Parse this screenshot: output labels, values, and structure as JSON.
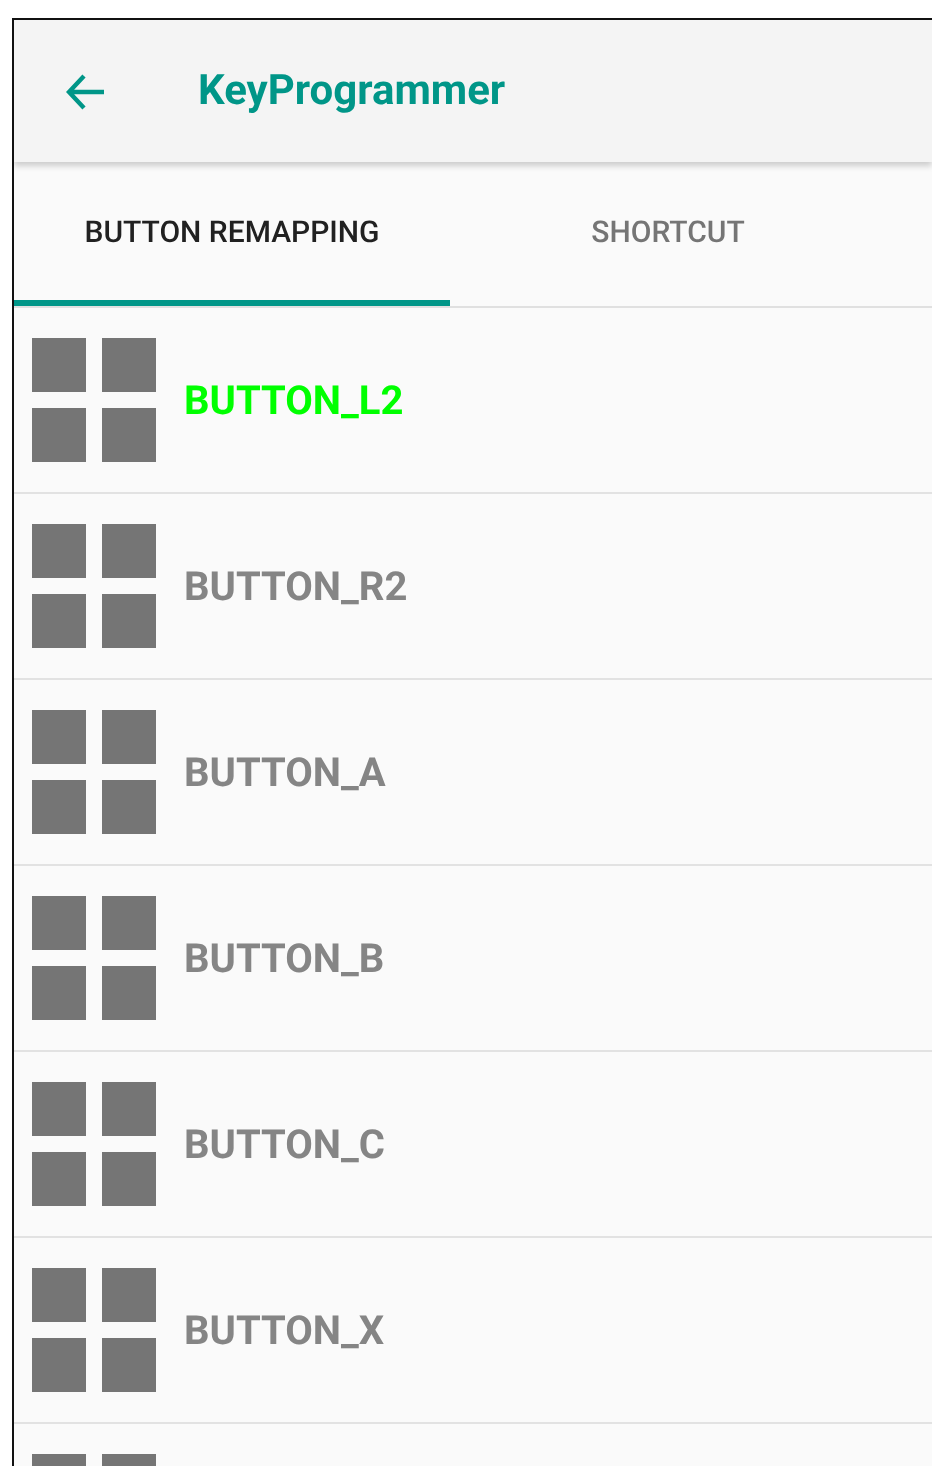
{
  "app_bar": {
    "title": "KeyProgrammer"
  },
  "tabs": [
    {
      "label": "BUTTON REMAPPING",
      "selected": true
    },
    {
      "label": "SHORTCUT",
      "selected": false
    }
  ],
  "buttons": [
    {
      "label": "BUTTON_L2",
      "selected": true
    },
    {
      "label": "BUTTON_R2",
      "selected": false
    },
    {
      "label": "BUTTON_A",
      "selected": false
    },
    {
      "label": "BUTTON_B",
      "selected": false
    },
    {
      "label": "BUTTON_C",
      "selected": false
    },
    {
      "label": "BUTTON_X",
      "selected": false
    }
  ]
}
